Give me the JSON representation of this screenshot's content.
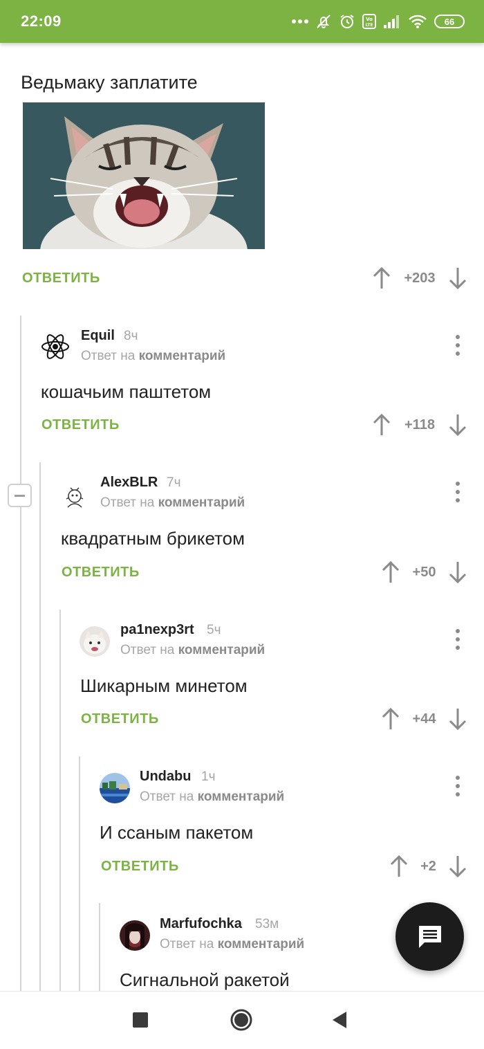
{
  "status_bar": {
    "time": "22:09",
    "battery": "66",
    "icons": [
      "more-dots-icon",
      "bell-off-icon",
      "alarm-icon",
      "volte-icon",
      "signal-icon",
      "wifi-icon",
      "battery-icon"
    ],
    "color": "#7cb342"
  },
  "post": {
    "title": "Ведьмаку заплатите",
    "image_desc": "kitten-image",
    "reply_label": "ОТВЕТИТЬ",
    "score": "+203"
  },
  "comments": [
    {
      "author": "Equil",
      "time": "8ч",
      "reply_prefix": "Ответ на",
      "reply_target": "комментарий",
      "text": "кошачьим паштетом",
      "reply_label": "ОТВЕТИТЬ",
      "score": "+118"
    },
    {
      "author": "AlexBLR",
      "time": "7ч",
      "reply_prefix": "Ответ на",
      "reply_target": "комментарий",
      "text": "квадратным брикетом",
      "reply_label": "ОТВЕТИТЬ",
      "score": "+50"
    },
    {
      "author": "pa1nexp3rt",
      "time": "5ч",
      "reply_prefix": "Ответ на",
      "reply_target": "комментарий",
      "text": "Шикарным минетом",
      "reply_label": "ОТВЕТИТЬ",
      "score": "+44"
    },
    {
      "author": "Undabu",
      "time": "1ч",
      "reply_prefix": "Ответ на",
      "reply_target": "комментарий",
      "text": "И ссаным пакетом",
      "reply_label": "ОТВЕТИТЬ",
      "score": "+2"
    },
    {
      "author": "Marfufochka",
      "time": "53м",
      "reply_prefix": "Ответ на",
      "reply_target": "комментарий",
      "text": "Сигнальной ракетой"
    }
  ],
  "colors": {
    "accent": "#7cb342",
    "muted": "#a6a6a6",
    "fab": "#1c1c1c"
  },
  "fab_icon": "chat-icon",
  "nav": [
    "recents-square-icon",
    "home-circle-icon",
    "back-triangle-icon"
  ]
}
